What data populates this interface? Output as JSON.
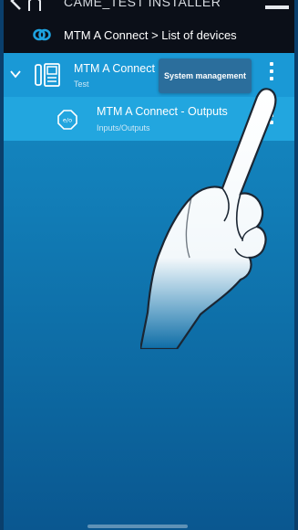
{
  "header": {
    "app_title": "CAME_TEST INSTALLER",
    "breadcrumb": "MTM A Connect > List of devices"
  },
  "device": {
    "title": "MTM A Connect",
    "subtitle": "Test"
  },
  "tooltip": {
    "label": "System management"
  },
  "output_item": {
    "title": "MTM A Connect - Outputs",
    "subtitle": "Inputs/Outputs"
  },
  "colors": {
    "header_bg": "#0b0f18",
    "device_row_bg": "#1a99d6",
    "output_row_bg": "#22a6df",
    "tooltip_bg": "#2b6e9c",
    "accent_link": "#1ea3e0"
  },
  "icons": {
    "back": "chevron-left-icon",
    "home": "home-icon",
    "menu": "hamburger-menu-icon",
    "link": "link-icon",
    "expand": "chevron-down-icon",
    "device": "intercom-device-icon",
    "output": "io-output-icon",
    "more": "kebab-menu-icon"
  }
}
